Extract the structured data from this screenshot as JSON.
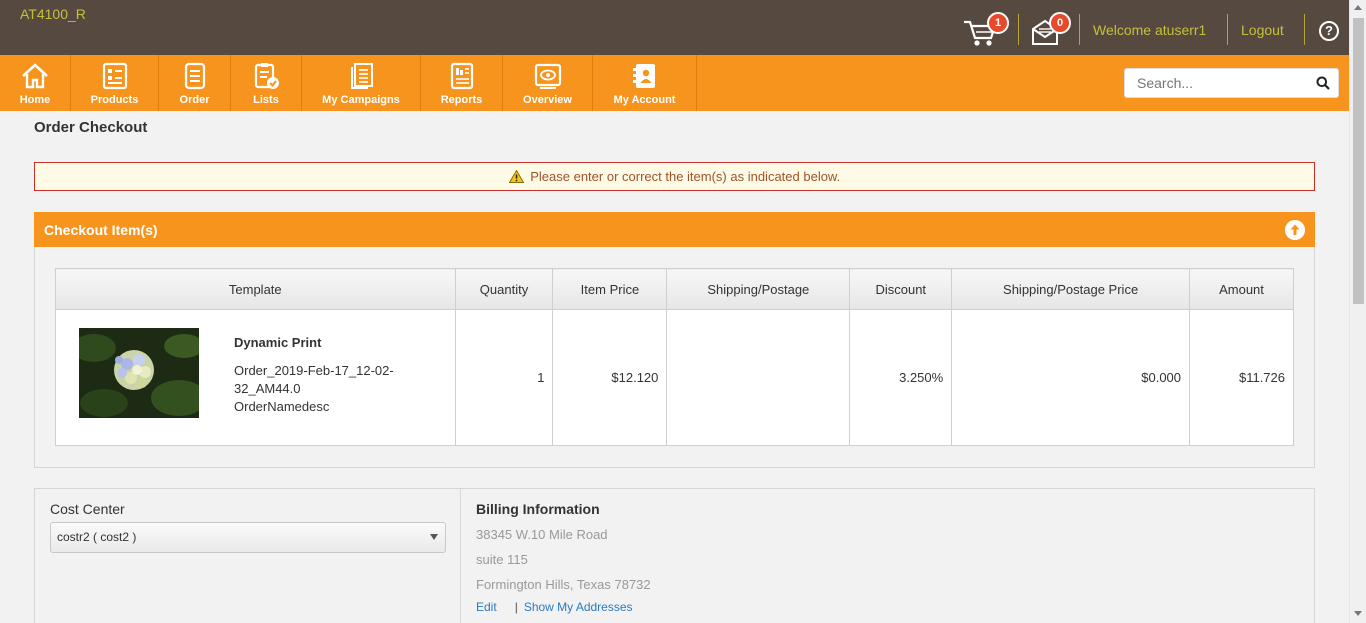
{
  "app": {
    "brand": "AT4100_R"
  },
  "header": {
    "cart_count": "1",
    "message_count": "0",
    "welcome": "Welcome atuserr1",
    "logout": "Logout",
    "help": "?"
  },
  "nav": {
    "items": [
      {
        "label": "Home",
        "icon": "home-icon"
      },
      {
        "label": "Products",
        "icon": "products-icon"
      },
      {
        "label": "Order",
        "icon": "order-icon"
      },
      {
        "label": "Lists",
        "icon": "lists-icon"
      },
      {
        "label": "My Campaigns",
        "icon": "campaigns-icon"
      },
      {
        "label": "Reports",
        "icon": "reports-icon"
      },
      {
        "label": "Overview",
        "icon": "overview-icon"
      },
      {
        "label": "My Account",
        "icon": "account-icon"
      }
    ],
    "search_placeholder": "Search..."
  },
  "page": {
    "title": "Order Checkout",
    "alert": "Please enter or correct the item(s) as indicated below."
  },
  "checkout": {
    "title": "Checkout Item(s)",
    "columns": [
      "Template",
      "Quantity",
      "Item Price",
      "Shipping/Postage",
      "Discount",
      "Shipping/Postage Price",
      "Amount"
    ],
    "row": {
      "name": "Dynamic Print",
      "order": "Order_2019-Feb-17_12-02-32_AM44.0",
      "desc": "OrderNamedesc",
      "quantity": "1",
      "item_price": "$12.120",
      "shipping": "",
      "discount": "3.250%",
      "shipping_price": "$0.000",
      "amount": "$11.726"
    }
  },
  "cost_center": {
    "label": "Cost Center",
    "selected": "costr2 ( cost2 )"
  },
  "billing": {
    "label": "Billing Information",
    "line1": "38345 W.10 Mile Road",
    "line2": "suite 115",
    "line3": "Formington Hills, Texas 78732",
    "edit": "Edit",
    "show": "Show My Addresses"
  },
  "colors": {
    "topbar": "#564940",
    "accent": "#f7941d",
    "badge": "#e8492b",
    "header_text": "#c5c03a"
  }
}
